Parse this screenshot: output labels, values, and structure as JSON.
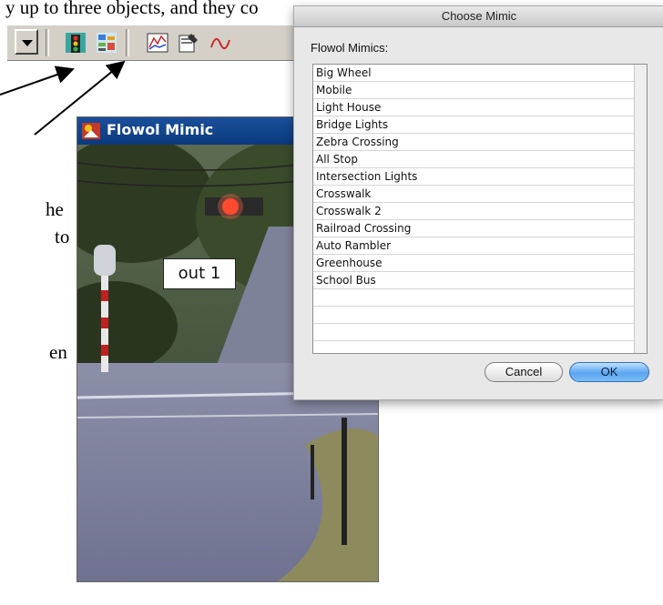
{
  "document": {
    "top_text": "y up to three objects, and they co",
    "frag_the": "he",
    "frag_to": "to",
    "frag_en": "en"
  },
  "toolbar": {
    "icons": [
      "dropdown-arrow",
      "traffic-light-mimic-icon",
      "choose-mimic-icon",
      "chart-icon",
      "properties-icon",
      "waveform-icon"
    ]
  },
  "mimic_window": {
    "title": "Flowol Mimic",
    "output_label": "out 1"
  },
  "dialog": {
    "title": "Choose Mimic",
    "list_label": "Flowol Mimics:",
    "items": [
      "Big Wheel",
      "Mobile",
      "Light House",
      "Bridge Lights",
      "Zebra Crossing",
      "All Stop",
      "Intersection Lights",
      "Crosswalk",
      "Crosswalk 2",
      "Railroad Crossing",
      "Auto Rambler",
      "Greenhouse",
      "School Bus"
    ],
    "cancel_label": "Cancel",
    "ok_label": "OK"
  },
  "colors": {
    "ok_button": "#5aa6f0",
    "titlebar": "#1b4f9a"
  }
}
